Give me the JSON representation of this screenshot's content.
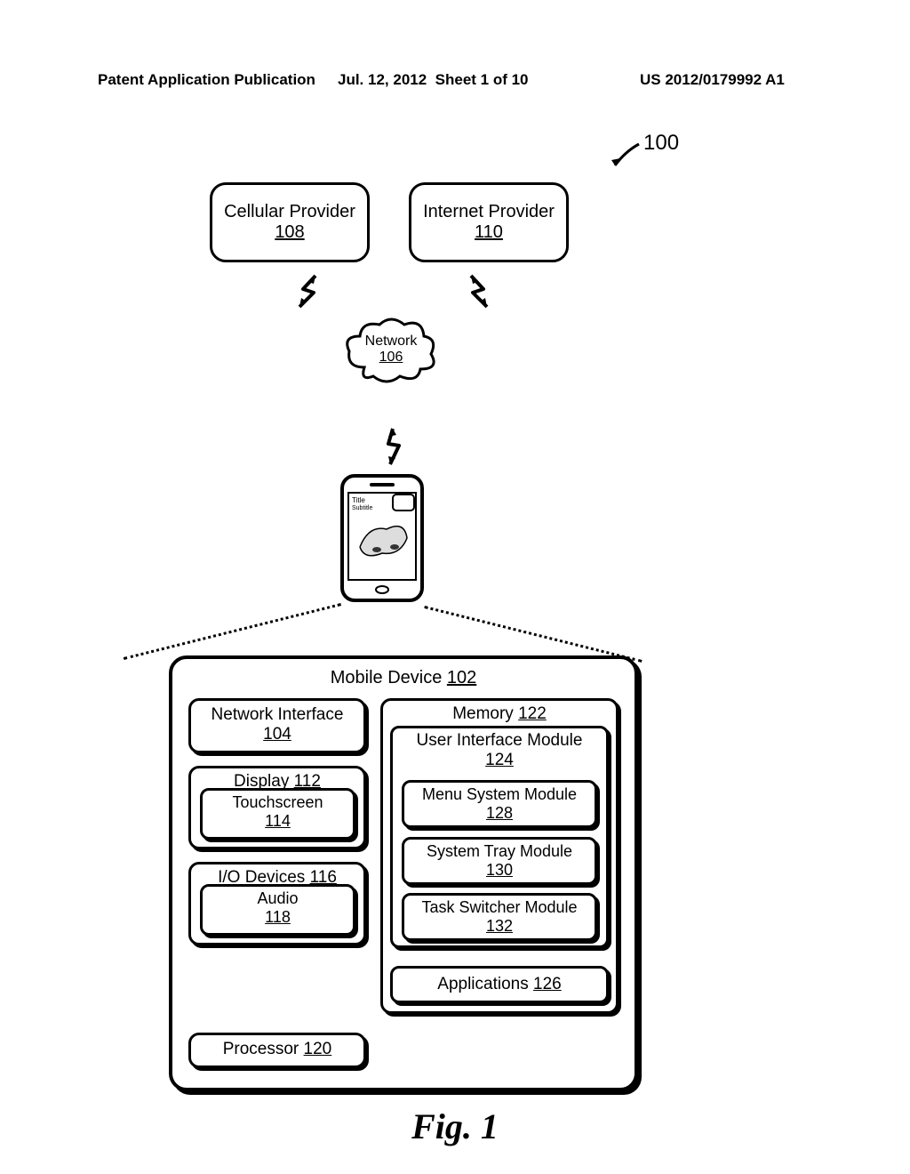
{
  "header": {
    "publication": "Patent Application Publication",
    "date": "Jul. 12, 2012",
    "sheet": "Sheet 1 of 10",
    "pubnum": "US 2012/0179992 A1"
  },
  "figure_ref": "100",
  "cellular": {
    "label": "Cellular Provider",
    "ref": "108"
  },
  "internet": {
    "label": "Internet Provider",
    "ref": "110"
  },
  "network": {
    "label": "Network",
    "ref": "106"
  },
  "phone": {
    "title": "Title",
    "subtitle": "Subtitle"
  },
  "mobile": {
    "label": "Mobile Device",
    "ref": "102",
    "netif": {
      "label": "Network Interface",
      "ref": "104"
    },
    "display": {
      "label": "Display",
      "ref": "112"
    },
    "touchscreen": {
      "label": "Touchscreen",
      "ref": "114"
    },
    "io": {
      "label": "I/O Devices",
      "ref": "116"
    },
    "audio": {
      "label": "Audio",
      "ref": "118"
    },
    "processor": {
      "label": "Processor",
      "ref": "120"
    },
    "memory": {
      "label": "Memory",
      "ref": "122"
    },
    "uim": {
      "label": "User Interface Module",
      "ref": "124"
    },
    "msm": {
      "label": "Menu System Module",
      "ref": "128"
    },
    "stm": {
      "label": "System Tray Module",
      "ref": "130"
    },
    "tsm": {
      "label": "Task Switcher Module",
      "ref": "132"
    },
    "apps": {
      "label": "Applications",
      "ref": "126"
    }
  },
  "fig": "Fig. 1"
}
